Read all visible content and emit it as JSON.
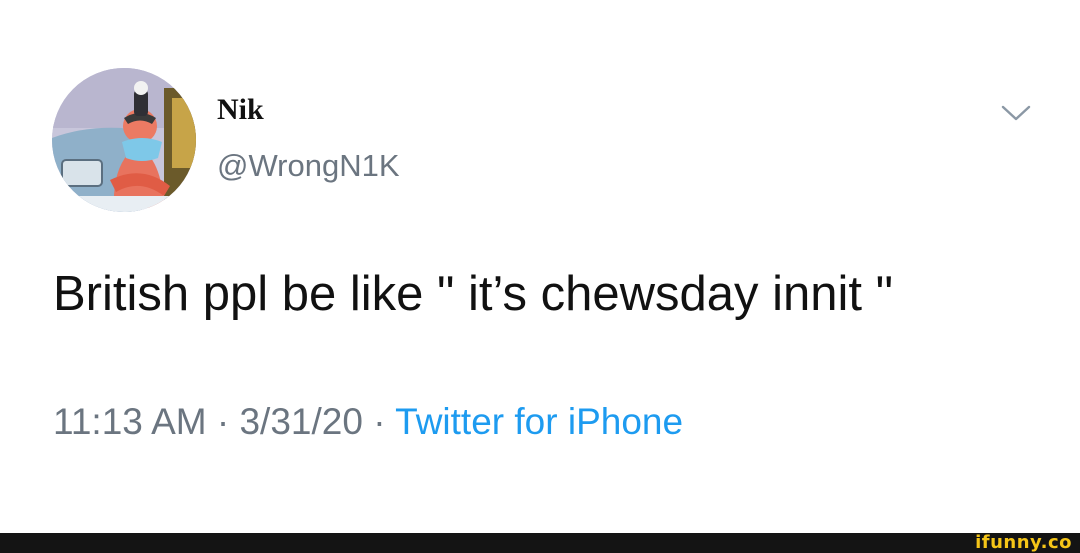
{
  "tweet": {
    "display_name": "Nik",
    "handle": "@WrongN1K",
    "text": "British ppl be like \" it’s chewsday innit \"",
    "time": "11:13 AM",
    "separator": " · ",
    "date": "3/31/20",
    "source": "Twitter for iPhone"
  },
  "icons": {
    "menu": "chevron-down-icon",
    "avatar": "avatar-image"
  },
  "watermark": {
    "text": "ifunny.co"
  },
  "colors": {
    "text": "#111111",
    "muted": "#6b7580",
    "link": "#1d9bf0",
    "footer": "#141414",
    "watermark": "#f5c518"
  }
}
